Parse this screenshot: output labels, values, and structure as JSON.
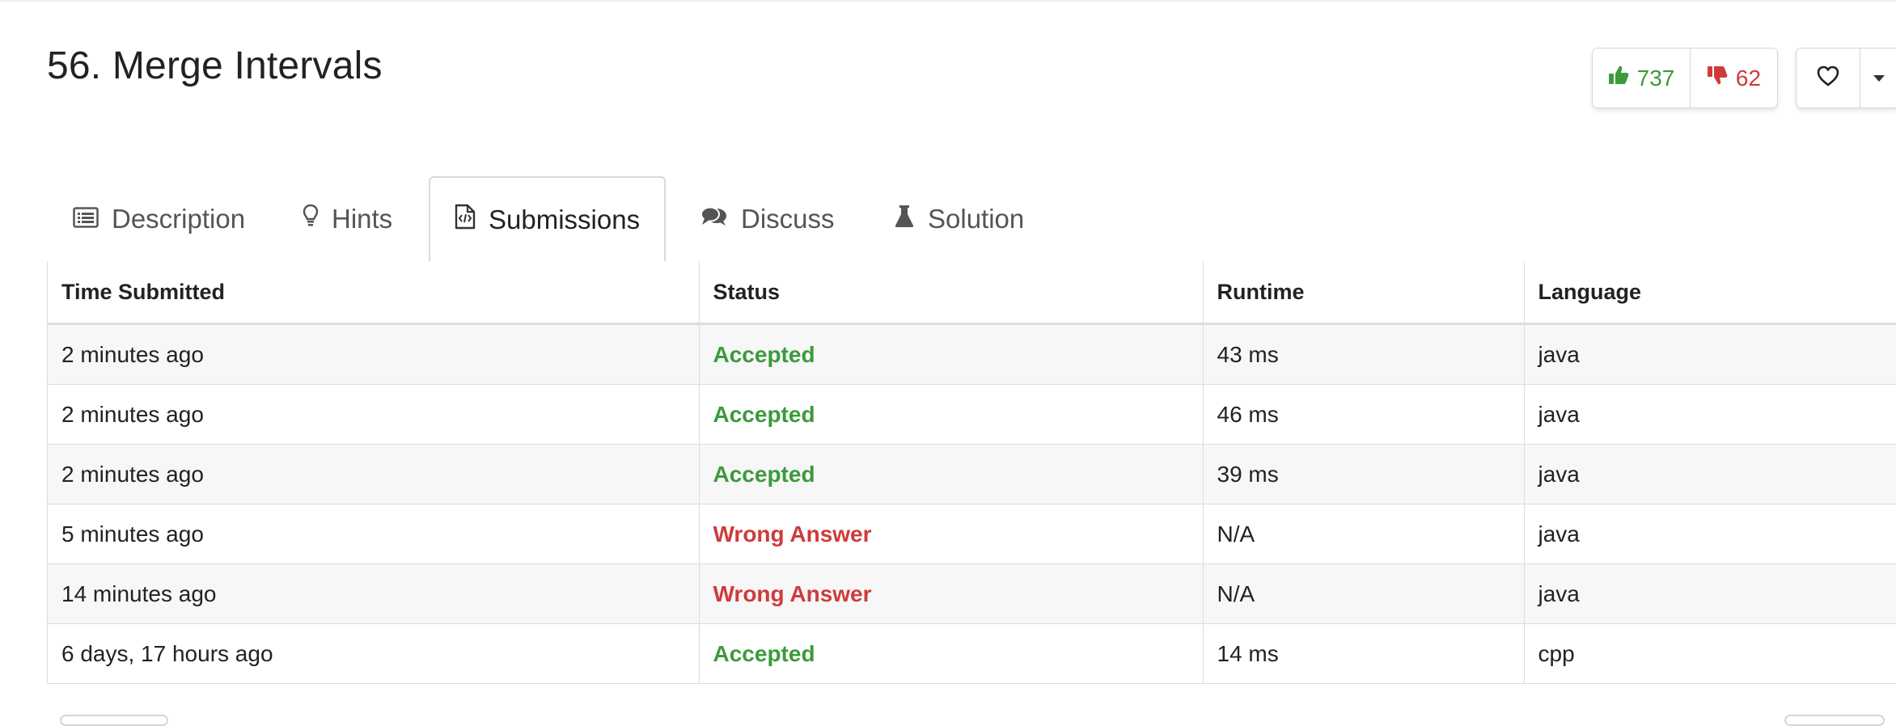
{
  "problem": {
    "title": "56. Merge Intervals"
  },
  "votes": {
    "likes": "737",
    "dislikes": "62"
  },
  "tabs": [
    {
      "label": "Description",
      "icon": "list-icon"
    },
    {
      "label": "Hints",
      "icon": "lightbulb-icon"
    },
    {
      "label": "Submissions",
      "icon": "code-file-icon",
      "active": true
    },
    {
      "label": "Discuss",
      "icon": "comments-icon"
    },
    {
      "label": "Solution",
      "icon": "flask-icon"
    }
  ],
  "table": {
    "headers": [
      "Time Submitted",
      "Status",
      "Runtime",
      "Language"
    ],
    "rows": [
      {
        "time": "2 minutes ago",
        "status": "Accepted",
        "runtime": "43 ms",
        "language": "java"
      },
      {
        "time": "2 minutes ago",
        "status": "Accepted",
        "runtime": "46 ms",
        "language": "java"
      },
      {
        "time": "2 minutes ago",
        "status": "Accepted",
        "runtime": "39 ms",
        "language": "java"
      },
      {
        "time": "5 minutes ago",
        "status": "Wrong Answer",
        "runtime": "N/A",
        "language": "java"
      },
      {
        "time": "14 minutes ago",
        "status": "Wrong Answer",
        "runtime": "N/A",
        "language": "java"
      },
      {
        "time": "6 days, 17 hours ago",
        "status": "Accepted",
        "runtime": "14 ms",
        "language": "cpp"
      }
    ]
  },
  "colors": {
    "accepted": "#3c9a3c",
    "wrong": "#cf3b3b",
    "border": "#dcdcdc",
    "stripe": "#f7f7f7"
  }
}
